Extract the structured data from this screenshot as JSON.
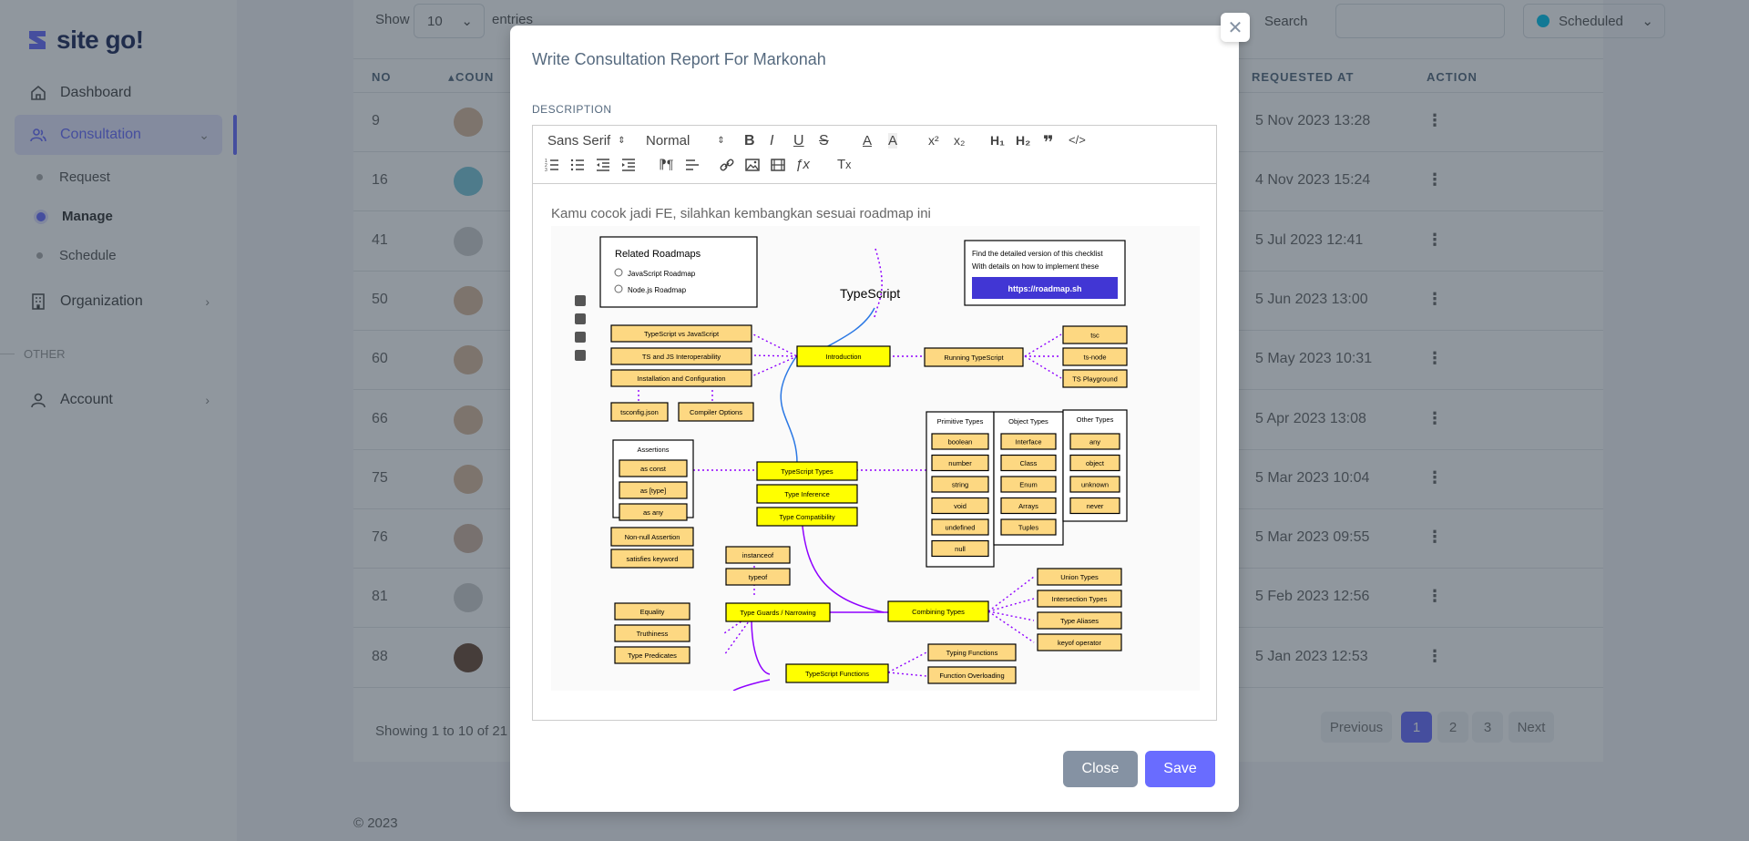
{
  "app": {
    "brand": "site go!"
  },
  "sidebar": {
    "items": [
      {
        "label": "Dashboard"
      },
      {
        "label": "Consultation"
      },
      {
        "label": "Organization"
      },
      {
        "label": "Account"
      }
    ],
    "sub_items": [
      {
        "label": "Request"
      },
      {
        "label": "Manage"
      },
      {
        "label": "Schedule"
      }
    ],
    "section_other": "OTHER"
  },
  "table": {
    "show_label": "Show",
    "entries_value": "10",
    "entries_label": "entries",
    "search_label": "Search",
    "status_value": "Scheduled",
    "headers": {
      "no": "NO",
      "counselee": "COUN",
      "requested_at": "REQUESTED AT",
      "action": "ACTION"
    },
    "rows": [
      {
        "no": "9",
        "requested": "5 Nov 2023 13:28"
      },
      {
        "no": "16",
        "requested": "4 Nov 2023 15:24"
      },
      {
        "no": "41",
        "requested": "5 Jul 2023 12:41"
      },
      {
        "no": "50",
        "requested": "5 Jun 2023 13:00"
      },
      {
        "no": "60",
        "requested": "5 May 2023 10:31"
      },
      {
        "no": "66",
        "requested": "5 Apr 2023 13:08"
      },
      {
        "no": "75",
        "requested": "5 Mar 2023 10:04"
      },
      {
        "no": "76",
        "requested": "5 Mar 2023 09:55"
      },
      {
        "no": "81",
        "requested": "5 Feb 2023 12:56"
      },
      {
        "no": "88",
        "requested": "5 Jan 2023 12:53"
      }
    ],
    "showing_text": "Showing 1 to 10 of 21 e",
    "pagination": {
      "previous": "Previous",
      "pages": [
        "1",
        "2",
        "3"
      ],
      "next": "Next"
    }
  },
  "footer": {
    "copyright": "© 2023"
  },
  "modal": {
    "title": "Write Consultation Report For Markonah",
    "description_label": "DESCRIPTION",
    "toolbar": {
      "font_value": "Sans Serif",
      "size_value": "Normal",
      "superscript": "x²",
      "subscript": "x₂",
      "h1": "H₁",
      "h2": "H₂"
    },
    "content_text": "Kamu cocok jadi FE, silahkan kembangkan sesuai roadmap ini",
    "roadmap": {
      "title": "TypeScript",
      "related_title": "Related Roadmaps",
      "related": [
        "JavaScript Roadmap",
        "Node.js Roadmap"
      ],
      "info_line1": "Find the detailed version of this checklist",
      "info_line2": "With details on how to implement these",
      "info_link": "https://roadmap.sh",
      "nodes": {
        "introduction": "Introduction",
        "ts_vs_js": "TypeScript vs JavaScript",
        "ts_js_interop": "TS and JS Interoperability",
        "install_config": "Installation and Configuration",
        "tsconfig": "tsconfig.json",
        "compiler_options": "Compiler Options",
        "running_ts": "Running TypeScript",
        "tsc": "tsc",
        "ts_node": "ts-node",
        "ts_playground": "TS Playground",
        "assertions": "Assertions",
        "as_const": "as const",
        "as_type": "as [type]",
        "as_any": "as any",
        "non_null": "Non-null Assertion",
        "satisfies": "satisfies keyword",
        "ts_types": "TypeScript Types",
        "type_inference": "Type Inference",
        "type_compat": "Type Compatibility",
        "primitive_types": "Primitive Types",
        "object_types": "Object Types",
        "other_types": "Other Types",
        "primitives": [
          "boolean",
          "number",
          "string",
          "void",
          "undefined",
          "null"
        ],
        "objects": [
          "Interface",
          "Class",
          "Enum",
          "Arrays",
          "Tuples"
        ],
        "others": [
          "any",
          "object",
          "unknown",
          "never"
        ],
        "instanceof": "instanceof",
        "typeof": "typeof",
        "equality": "Equality",
        "truthiness": "Truthiness",
        "type_predicates": "Type Predicates",
        "type_guards": "Type Guards / Narrowing",
        "combining": "Combining Types",
        "union": "Union Types",
        "intersection": "Intersection Types",
        "aliases": "Type Aliases",
        "keyof": "keyof operator",
        "ts_functions": "TypeScript Functions",
        "typing_functions": "Typing Functions",
        "function_overloading": "Function Overloading"
      }
    },
    "buttons": {
      "close": "Close",
      "save": "Save"
    }
  },
  "colors": {
    "accent": "#696cff",
    "node_yellow": "#ffff00",
    "node_tan": "#fdd882",
    "overlay": "#22303e",
    "curve_purple": "#8f00ff",
    "curve_blue": "#2b78e4",
    "link_bg": "#4136d4"
  }
}
